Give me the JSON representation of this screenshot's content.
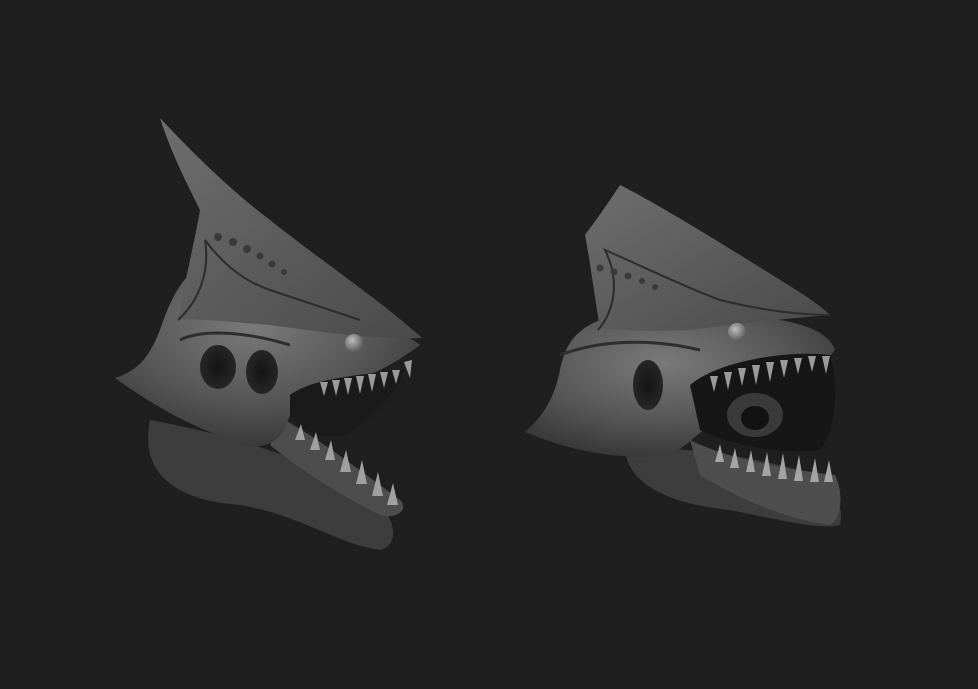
{
  "scene": {
    "background_color": "#1f1f1f",
    "material_color": "#5a5a5a",
    "models": [
      {
        "name": "creature-head-side-view",
        "view": "side"
      },
      {
        "name": "creature-head-three-quarter-view",
        "view": "three-quarter"
      }
    ]
  }
}
